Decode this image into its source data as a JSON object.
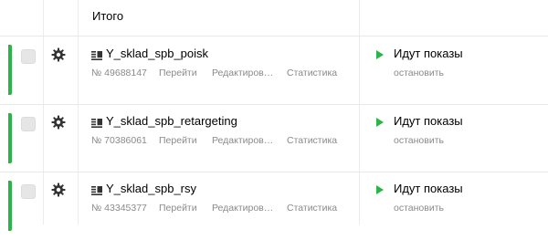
{
  "totals": {
    "label": "Итого"
  },
  "colors": {
    "active": "#2cb34a",
    "muted": "#8a8a8a"
  },
  "icons": {
    "settings": "gear-icon",
    "campaign": "campaign-type-icon",
    "status": "play-icon"
  },
  "campaigns": [
    {
      "name": "Y_sklad_spb_poisk",
      "number": "№ 49688147",
      "go_label": "Перейти",
      "edit_label": "Редактиров…",
      "stats_label": "Статистика",
      "status": "Идут показы",
      "stop_label": "остановить"
    },
    {
      "name": "Y_sklad_spb_retargeting",
      "number": "№ 70386061",
      "go_label": "Перейти",
      "edit_label": "Редактиров…",
      "stats_label": "Статистика",
      "status": "Идут показы",
      "stop_label": "остановить"
    },
    {
      "name": "Y_sklad_spb_rsy",
      "number": "№ 43345377",
      "go_label": "Перейти",
      "edit_label": "Редактиров…",
      "stats_label": "Статистика",
      "status": "Идут показы",
      "stop_label": "остановить"
    }
  ]
}
